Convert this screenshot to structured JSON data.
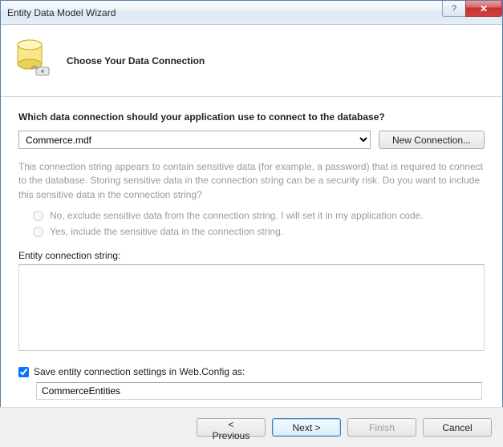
{
  "window": {
    "title": "Entity Data Model Wizard"
  },
  "header": {
    "title": "Choose Your Data Connection"
  },
  "question": "Which data connection should your application use to connect to the database?",
  "connection": {
    "selected": "Commerce.mdf",
    "new_button": "New Connection..."
  },
  "info": "This connection string appears to contain sensitive data (for example, a password) that is required to connect to the database. Storing sensitive data in the connection string can be a security risk. Do you want to include this sensitive data in the connection string?",
  "radios": {
    "exclude": "No, exclude sensitive data from the connection string. I will set it in my application code.",
    "include": "Yes, include the sensitive data in the connection string."
  },
  "ecs_label": "Entity connection string:",
  "ecs_value": "",
  "save_check": {
    "checked": true,
    "label": "Save entity connection settings in Web.Config as:",
    "value": "CommerceEntities"
  },
  "footer": {
    "previous": "< Previous",
    "next": "Next >",
    "finish": "Finish",
    "cancel": "Cancel"
  }
}
